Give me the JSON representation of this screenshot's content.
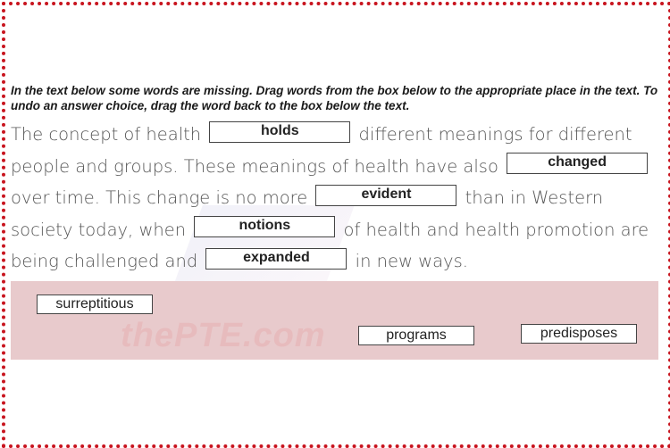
{
  "instructions": "In the text below some words are missing. Drag words from the box below to the appropriate place in the text. To undo an answer choice, drag the word back to the box below the text.",
  "passage": {
    "seg0": "The concept of health",
    "blank1": "holds",
    "seg1": "different meanings for different people and groups. These meanings of health have also",
    "blank2": "changed",
    "seg2": "over time. This change is no more",
    "blank3": "evident",
    "seg3": "than in Western society today, when",
    "blank4": "notions",
    "seg4": "of health and health promotion are being challenged and",
    "blank5": "expanded",
    "seg5": "in new ways."
  },
  "word_bank": [
    "surreptitious",
    "programs",
    "predisposes"
  ],
  "watermark": "thePTE.com",
  "colors": {
    "border": "#c8141e",
    "bank_bg": "#e8cacc"
  }
}
